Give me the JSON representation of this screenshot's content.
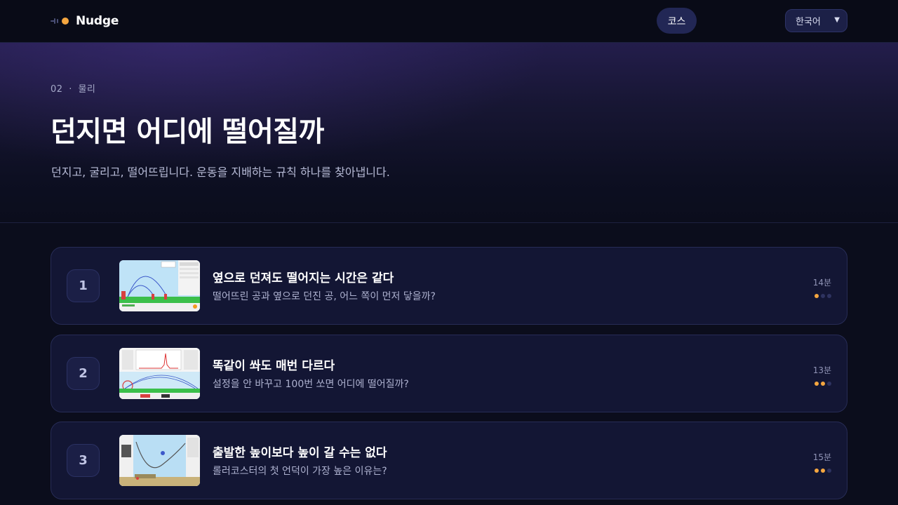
{
  "nav": {
    "brand": "Nudge",
    "course_label": "코스",
    "language_selected": "한국어"
  },
  "hero": {
    "eyebrow_number": "02",
    "eyebrow_separator": "·",
    "eyebrow_subject": "물리",
    "title": "던지면 어디에 떨어질까",
    "subtitle": "던지고, 굴리고, 떨어뜨립니다. 운동을 지배하는 규칙 하나를 찾아냅니다."
  },
  "lessons": [
    {
      "number": "1",
      "title": "옆으로 던져도 떨어지는 시간은 같다",
      "description": "떨어뜨린 공과 옆으로 던진 공, 어느 쪽이 먼저 닿을까?",
      "duration": "14분",
      "difficulty": 1,
      "difficulty_max": 3
    },
    {
      "number": "2",
      "title": "똑같이 쏴도 매번 다르다",
      "description": "설정을 안 바꾸고 100번 쏘면 어디에 떨어질까?",
      "duration": "13분",
      "difficulty": 2,
      "difficulty_max": 3
    },
    {
      "number": "3",
      "title": "출발한 높이보다 높이 갈 수는 없다",
      "description": "롤러코스터의 첫 언덕이 가장 높은 이유는?",
      "duration": "15분",
      "difficulty": 2,
      "difficulty_max": 3
    }
  ],
  "colors": {
    "accent": "#f4a640",
    "background": "#0b0d1c",
    "card": "#131634"
  }
}
